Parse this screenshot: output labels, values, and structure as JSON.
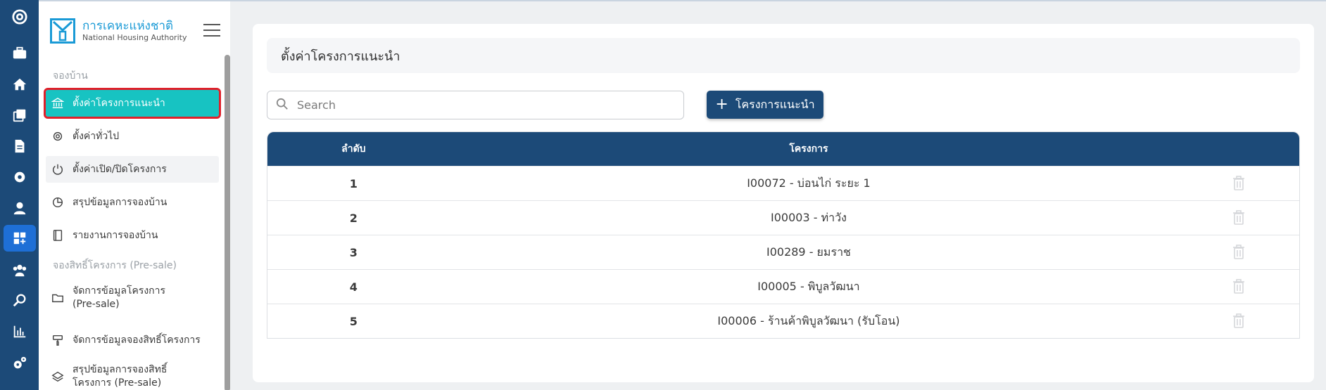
{
  "brand": {
    "thai": "การเคหะแห่งชาติ",
    "english": "National Housing Authority"
  },
  "rail": {
    "icons": [
      "app-logo-icon",
      "briefcase-icon",
      "home-icon",
      "copy-icon",
      "document-icon",
      "settings-icon",
      "user-icon",
      "dashboard-add-icon",
      "users-group-icon",
      "search-icon",
      "bar-chart-icon",
      "cogs-icon"
    ],
    "active_color": "#1e6fd6",
    "background": "#1c4a78"
  },
  "sidebar": {
    "section1": "จองบ้าน",
    "section2": "จองสิทธิ์โครงการ (Pre-sale)",
    "items": [
      {
        "label": "ตั้งค่าโครงการแนะนำ",
        "icon": "bank-icon",
        "active": true
      },
      {
        "label": "ตั้งค่าทั่วไป",
        "icon": "gear-icon"
      },
      {
        "label": "ตั้งค่าเปิด/ปิดโครงการ",
        "icon": "power-icon"
      },
      {
        "label": "สรุปข้อมูลการจองบ้าน",
        "icon": "pie-chart-icon"
      },
      {
        "label": "รายงานการจองบ้าน",
        "icon": "book-icon"
      },
      {
        "label": "จัดการข้อมูลโครงการ (Pre-sale)",
        "icon": "folder-icon"
      },
      {
        "label": "จัดการข้อมูลจองสิทธิ์โครงการ",
        "icon": "paint-roller-icon"
      },
      {
        "label": "สรุปข้อมูลการจองสิทธิ์โครงการ (Pre-sale)",
        "icon": "layers-icon"
      }
    ]
  },
  "page": {
    "title": "ตั้งค่าโครงการแนะนำ",
    "search_placeholder": "Search",
    "add_button": "โครงการแนะนำ"
  },
  "table": {
    "headers": [
      "ลำดับ",
      "โครงการ",
      ""
    ],
    "rows": [
      {
        "no": "1",
        "project": "I00072 - บ่อนไก่ ระยะ 1"
      },
      {
        "no": "2",
        "project": "I00003 - ท่าวัง"
      },
      {
        "no": "3",
        "project": "I00289 - ยมราช"
      },
      {
        "no": "4",
        "project": "I00005 - พิบูลวัฒนา"
      },
      {
        "no": "5",
        "project": "I00006 - ร้านค้าพิบูลวัฒนา (รับโอน)"
      }
    ]
  },
  "colors": {
    "primary": "#1c4a78",
    "active_menu": "#17c3c2",
    "highlight_border": "#e0202a"
  }
}
